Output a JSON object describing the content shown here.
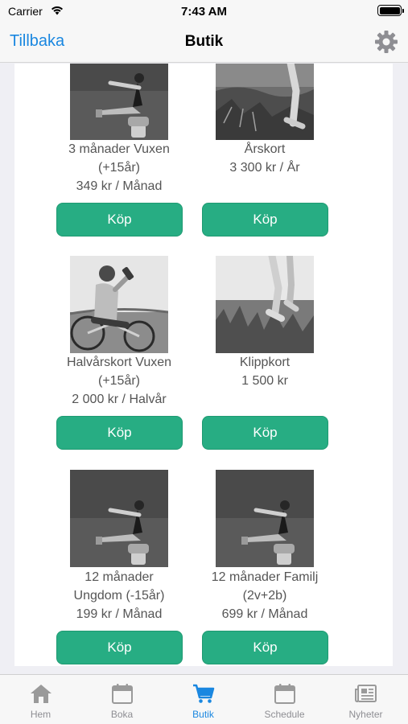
{
  "status_bar": {
    "carrier": "Carrier",
    "time": "7:43 AM"
  },
  "nav": {
    "back_label": "Tillbaka",
    "title": "Butik",
    "settings_icon": "gear-icon"
  },
  "products": [
    {
      "name": "3 månader Vuxen (+15år)",
      "lines": [
        "3 månader Vuxen",
        "(+15år)",
        "349 kr / Månad"
      ],
      "price": "349 kr / Månad",
      "buy_label": "Köp",
      "image": "fitness-pose-photo"
    },
    {
      "name": "Årskort",
      "lines": [
        "Årskort",
        "3 300 kr / År"
      ],
      "price": "3 300 kr / År",
      "buy_label": "Köp",
      "image": "runner-legs-photo"
    },
    {
      "name": "Halvårskort Vuxen (+15år)",
      "lines": [
        "Halvårskort Vuxen",
        "(+15år)",
        "2 000 kr / Halvår"
      ],
      "price": "2 000 kr / Halvår",
      "buy_label": "Köp",
      "image": "cyclist-drinking-photo"
    },
    {
      "name": "Klippkort",
      "lines": [
        "Klippkort",
        "1 500 kr"
      ],
      "price": "1 500 kr",
      "buy_label": "Köp",
      "image": "runner-grass-photo"
    },
    {
      "name": "12 månader Ungdom (-15år)",
      "lines": [
        "12 månader",
        "Ungdom (-15år)",
        "199 kr / Månad"
      ],
      "price": "199 kr / Månad",
      "buy_label": "Köp",
      "image": "fitness-pose-photo"
    },
    {
      "name": "12 månader Familj (2v+2b)",
      "lines": [
        "12 månader Familj",
        "(2v+2b)",
        "699 kr / Månad"
      ],
      "price": "699 kr / Månad",
      "buy_label": "Köp",
      "image": "fitness-pose-photo"
    }
  ],
  "tabs": [
    {
      "label": "Hem",
      "icon": "home-icon",
      "active": false
    },
    {
      "label": "Boka",
      "icon": "calendar-icon",
      "active": false
    },
    {
      "label": "Butik",
      "icon": "cart-icon",
      "active": true
    },
    {
      "label": "Schedule",
      "icon": "calendar-icon",
      "active": false
    },
    {
      "label": "Nyheter",
      "icon": "newspaper-icon",
      "active": false
    }
  ],
  "colors": {
    "accent": "#1a87e0",
    "buy_button": "#27ad83",
    "inactive_tab": "#8e8e93"
  }
}
